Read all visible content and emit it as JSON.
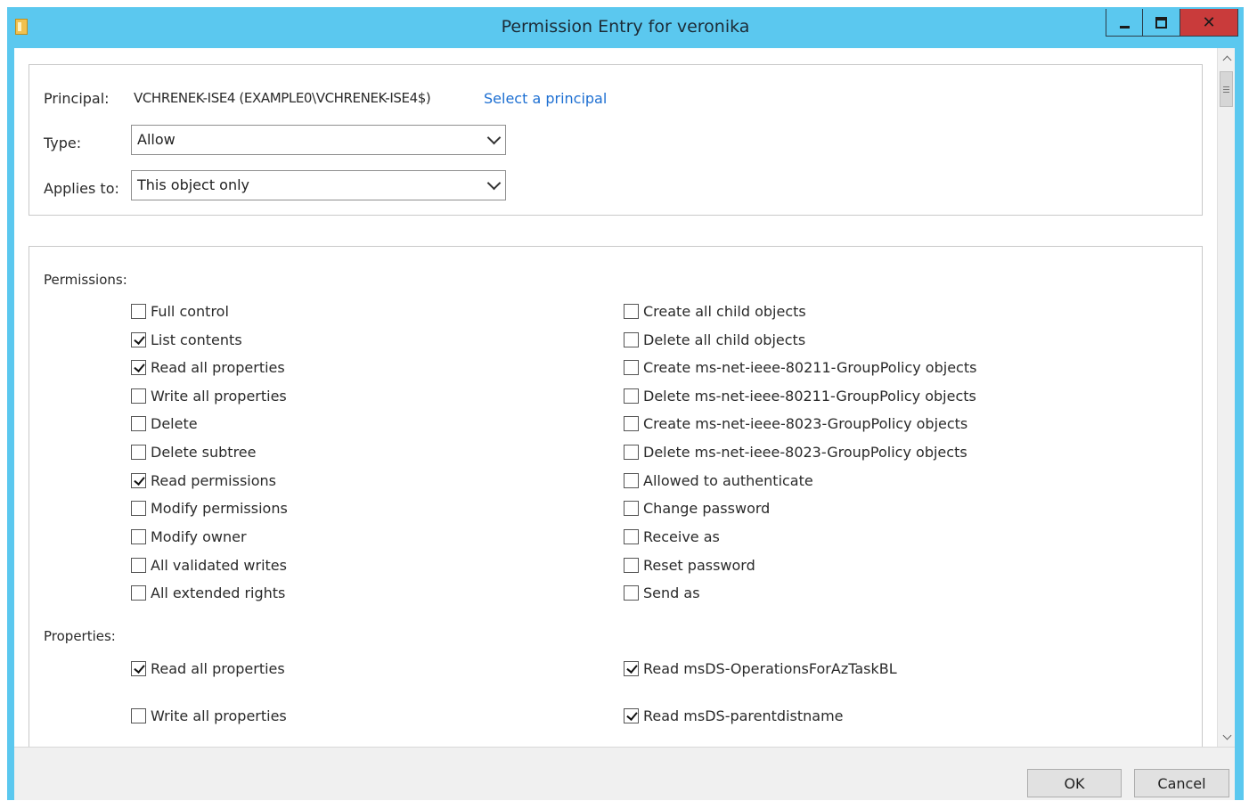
{
  "window": {
    "title": "Permission Entry for veronika"
  },
  "titlebar": {
    "close_glyph": "✕"
  },
  "principal": {
    "label": "Principal:",
    "value": "VCHRENEK-ISE4 (EXAMPLE0\\VCHRENEK-ISE4$)",
    "link": "Select a principal"
  },
  "type": {
    "label": "Type:",
    "value": "Allow"
  },
  "applies_to": {
    "label": "Applies to:",
    "value": "This object only"
  },
  "permissions": {
    "heading": "Permissions:",
    "left": [
      {
        "label": "Full control",
        "checked": false
      },
      {
        "label": "List contents",
        "checked": true
      },
      {
        "label": "Read all properties",
        "checked": true
      },
      {
        "label": "Write all properties",
        "checked": false
      },
      {
        "label": "Delete",
        "checked": false
      },
      {
        "label": "Delete subtree",
        "checked": false
      },
      {
        "label": "Read permissions",
        "checked": true
      },
      {
        "label": "Modify permissions",
        "checked": false
      },
      {
        "label": "Modify owner",
        "checked": false
      },
      {
        "label": "All validated writes",
        "checked": false
      },
      {
        "label": "All extended rights",
        "checked": false
      }
    ],
    "right": [
      {
        "label": "Create all child objects",
        "checked": false
      },
      {
        "label": "Delete all child objects",
        "checked": false
      },
      {
        "label": "Create ms-net-ieee-80211-GroupPolicy objects",
        "checked": false
      },
      {
        "label": "Delete ms-net-ieee-80211-GroupPolicy objects",
        "checked": false
      },
      {
        "label": "Create ms-net-ieee-8023-GroupPolicy objects",
        "checked": false
      },
      {
        "label": "Delete ms-net-ieee-8023-GroupPolicy objects",
        "checked": false
      },
      {
        "label": "Allowed to authenticate",
        "checked": false
      },
      {
        "label": "Change password",
        "checked": false
      },
      {
        "label": "Receive as",
        "checked": false
      },
      {
        "label": "Reset password",
        "checked": false
      },
      {
        "label": "Send as",
        "checked": false
      }
    ]
  },
  "properties": {
    "heading": "Properties:",
    "left": [
      {
        "label": "Read all properties",
        "checked": true
      },
      {
        "label": "Write all properties",
        "checked": false
      }
    ],
    "right": [
      {
        "label": "Read msDS-OperationsForAzTaskBL",
        "checked": true
      },
      {
        "label": "Read msDS-parentdistname",
        "checked": true
      }
    ]
  },
  "buttons": {
    "ok": "OK",
    "cancel": "Cancel"
  }
}
